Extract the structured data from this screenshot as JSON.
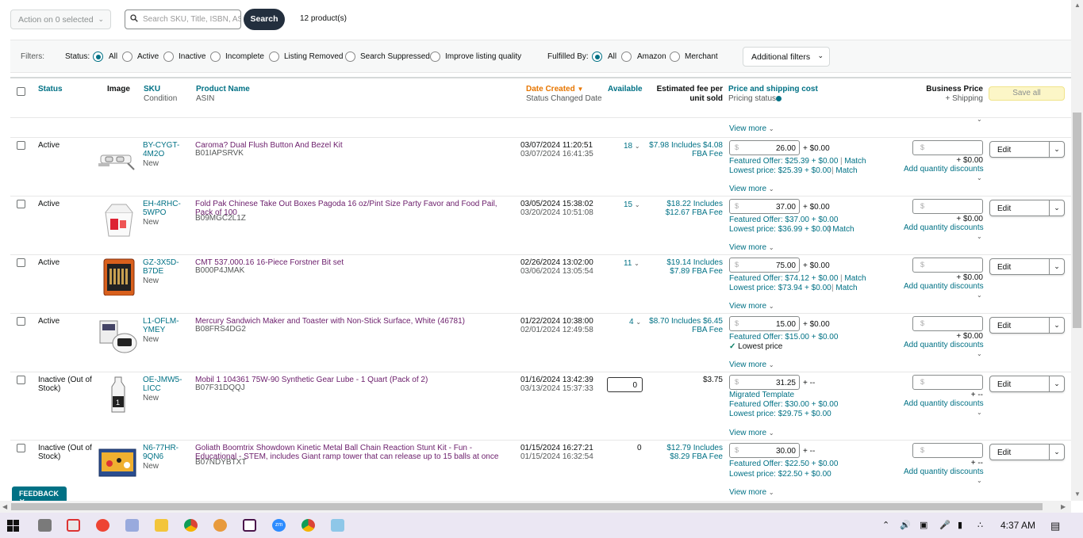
{
  "toolbar": {
    "action_label": "Action on 0 selected",
    "search_placeholder": "Search SKU, Title, ISBN, ASIN",
    "search_label": "Search",
    "product_count": "12 product(s)"
  },
  "filters": {
    "label": "Filters:",
    "status_label": "Status:",
    "status_options": [
      "All",
      "Active",
      "Inactive",
      "Incomplete",
      "Listing Removed",
      "Search Suppressed",
      "Improve listing quality"
    ],
    "status_selected": "All",
    "fulfilled_label": "Fulfilled By:",
    "fulfilled_options": [
      "All",
      "Amazon",
      "Merchant"
    ],
    "fulfilled_selected": "All",
    "additional_label": "Additional filters"
  },
  "columns": {
    "status": "Status",
    "image": "Image",
    "sku": "SKU",
    "condition": "Condition",
    "product_name": "Product Name",
    "asin": "ASIN",
    "date_created": "Date Created",
    "status_changed": "Status Changed Date",
    "available": "Available",
    "fee_line1": "Estimated fee per",
    "fee_line2": "unit sold",
    "price_shipping": "Price and shipping cost",
    "pricing_status": "Pricing status",
    "business_price": "Business Price",
    "plus_shipping": "+ Shipping",
    "save_all": "Save all"
  },
  "view_more": "View more",
  "add_qty_discounts": "Add quantity discounts",
  "edit_label": "Edit",
  "match_label": "Match",
  "rows": [
    {
      "status_line1": "Active",
      "status_line2": "",
      "sku_line1": "BY-CYGT-",
      "sku_line2": "4M2O",
      "condition": "New",
      "name": "Caroma? Dual Flush Button And Bezel Kit",
      "asin": "B01IAPSRVK",
      "created": "03/07/2024 11:20:51",
      "changed": "03/07/2024 16:41:35",
      "available": "18",
      "fee_line1": "$7.98 Includes $4.08",
      "fee_line2": "FBA Fee",
      "price": "26.00",
      "shipping": "+ $0.00",
      "featured": "Featured Offer: $25.39 + $0.00",
      "featured_match": true,
      "lowest": "Lowest price: $25.39 + $0.00",
      "lowest_match": true,
      "biz_shipping": "+ $0.00"
    },
    {
      "status_line1": "Active",
      "status_line2": "",
      "sku_line1": "EH-4RHC-",
      "sku_line2": "5WPO",
      "condition": "New",
      "name": "Fold Pak Chinese Take Out Boxes Pagoda 16 oz/Pint Size Party Favor and Food Pail, Pack of 100",
      "asin": "B09MGC2L1Z",
      "created": "03/05/2024 15:38:02",
      "changed": "03/20/2024 10:51:08",
      "available": "15",
      "fee_line1": "$18.22 Includes",
      "fee_line2": "$12.67 FBA Fee",
      "price": "37.00",
      "shipping": "+ $0.00",
      "featured": "Featured Offer: $37.00 + $0.00",
      "featured_match": false,
      "lowest": "Lowest price: $36.99 + $0.00",
      "lowest_match": true,
      "biz_shipping": "+ $0.00"
    },
    {
      "status_line1": "Active",
      "status_line2": "",
      "sku_line1": "GZ-3X5D-",
      "sku_line2": "B7DE",
      "condition": "New",
      "name": "CMT 537.000.16 16-Piece Forstner Bit set",
      "asin": "B000P4JMAK",
      "created": "02/26/2024 13:02:00",
      "changed": "03/06/2024 13:05:54",
      "available": "11",
      "fee_line1": "$19.14 Includes",
      "fee_line2": "$7.89 FBA Fee",
      "price": "75.00",
      "shipping": "+ $0.00",
      "featured": "Featured Offer: $74.12 + $0.00",
      "featured_match": true,
      "lowest": "Lowest price: $73.94 + $0.00",
      "lowest_match": true,
      "biz_shipping": "+ $0.00"
    },
    {
      "status_line1": "Active",
      "status_line2": "",
      "sku_line1": "L1-OFLM-",
      "sku_line2": "YMEY",
      "condition": "New",
      "name": "Mercury Sandwich Maker and Toaster with Non-Stick Surface, White (46781)",
      "asin": "B08FRS4DG2",
      "created": "01/22/2024 10:38:00",
      "changed": "02/01/2024 12:49:58",
      "available": "4",
      "fee_line1": "$8.70 Includes $6.45",
      "fee_line2": "FBA Fee",
      "price": "15.00",
      "shipping": "+ $0.00",
      "featured": "Featured Offer: $15.00 + $0.00",
      "featured_match": false,
      "lowest": "Lowest price",
      "lowest_match": false,
      "lowest_check": true,
      "biz_shipping": "+ $0.00"
    },
    {
      "status_line1": "Inactive (Out of",
      "status_line2": "Stock)",
      "sku_line1": "OE-JMW5-",
      "sku_line2": "LICC",
      "condition": "New",
      "name": "Mobil 1 104361 75W-90 Synthetic Gear Lube - 1 Quart (Pack of 2)",
      "asin": "B07F31DQQJ",
      "created": "01/16/2024 13:42:39",
      "changed": "03/13/2024 15:37:33",
      "available": "0",
      "fee_line1": "$3.75",
      "fee_line2": "",
      "price": "31.25",
      "shipping": "+ --",
      "template": "Migrated Template",
      "featured": "Featured Offer: $30.00 + $0.00",
      "featured_match": false,
      "lowest": "Lowest price: $29.75 + $0.00",
      "lowest_match": false,
      "biz_shipping": "+ --"
    },
    {
      "status_line1": "Inactive (Out of",
      "status_line2": "Stock)",
      "sku_line1": "N6-77HR-",
      "sku_line2": "9QN6",
      "condition": "New",
      "name": "Goliath Boomtrix Showdown Kinetic Metal Ball Chain Reaction Stunt Kit - Fun - Educational - STEM, includes Giant ramp tower that can release up to 15 balls at once",
      "asin": "B07NDYBTXT",
      "created": "01/15/2024 16:27:21",
      "changed": "01/15/2024 16:32:54",
      "available": "0",
      "fee_line1": "$12.79 Includes",
      "fee_line2": "$8.29 FBA Fee",
      "price": "30.00",
      "shipping": "+ --",
      "featured": "Featured Offer: $22.50 + $0.00",
      "featured_match": false,
      "lowest": "Lowest price: $22.50 + $0.00",
      "lowest_match": false,
      "biz_shipping": "+ --"
    }
  ],
  "feedback_label": "FEEDBACK",
  "taskbar": {
    "time": "4:37 AM"
  }
}
